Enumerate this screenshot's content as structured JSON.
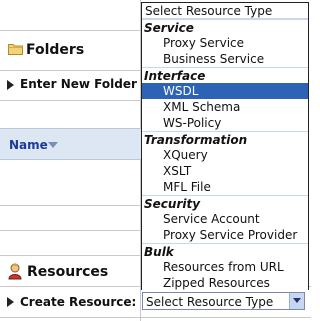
{
  "folders_panel": {
    "title": "Folders",
    "enter_new_folder_label": "Enter New Folder Na"
  },
  "table": {
    "name_column": "Name"
  },
  "resources_panel": {
    "title": "Resources",
    "create_resource_label": "Create Resource:"
  },
  "select": {
    "value": "Select Resource Type"
  },
  "dropdown": {
    "title": "Select Resource Type",
    "groups": [
      {
        "header": "Service",
        "options": [
          "Proxy Service",
          "Business Service"
        ]
      },
      {
        "header": "Interface",
        "options": [
          "WSDL",
          "XML Schema",
          "WS-Policy"
        ]
      },
      {
        "header": "Transformation",
        "options": [
          "XQuery",
          "XSLT",
          "MFL File"
        ]
      },
      {
        "header": "Security",
        "options": [
          "Service Account",
          "Proxy Service Provider"
        ]
      },
      {
        "header": "Bulk",
        "options": [
          "Resources from URL",
          "Zipped Resources"
        ]
      }
    ],
    "highlighted": "WSDL"
  },
  "colors": {
    "highlight": "#2d63b6",
    "header_band": "#dde6f3",
    "link_blue": "#1a3c98"
  }
}
